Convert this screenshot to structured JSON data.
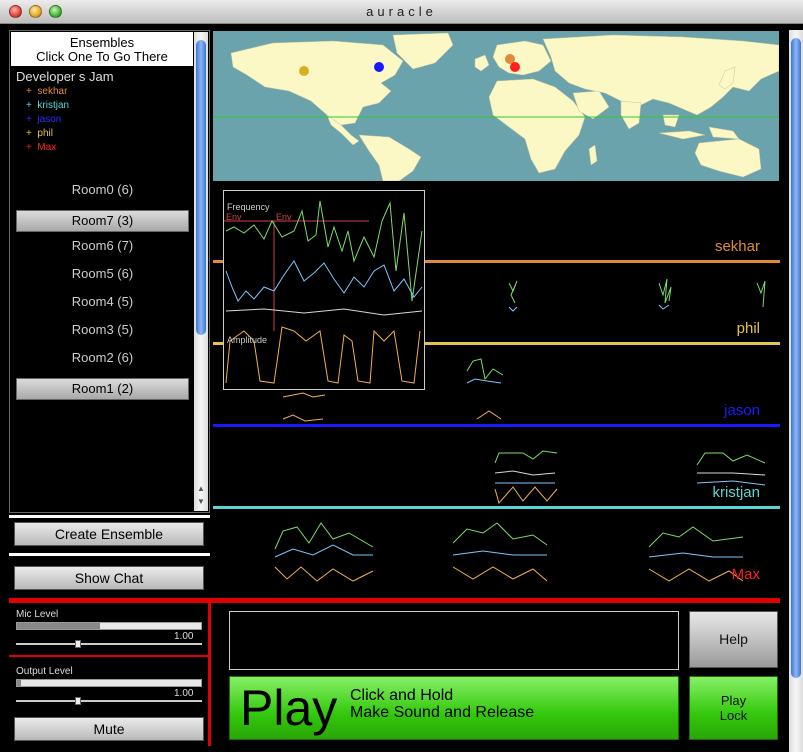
{
  "window": {
    "title": "auracle"
  },
  "ensembles": {
    "header_line1": "Ensembles",
    "header_line2": "Click One To Go There",
    "current": "Developer s Jam",
    "members": [
      {
        "name": "sekhar",
        "color": "#e08a3c"
      },
      {
        "name": "kristjan",
        "color": "#58d6d6"
      },
      {
        "name": "jason",
        "color": "#2a2aff"
      },
      {
        "name": "phil",
        "color": "#e6c34a"
      },
      {
        "name": "Max",
        "color": "#ff2020"
      }
    ],
    "rooms": [
      {
        "label": "Room0 (6)",
        "selected": false
      },
      {
        "label": "Room7 (3)",
        "selected": true
      },
      {
        "label": "Room6 (7)",
        "selected": false
      },
      {
        "label": "Room5 (6)",
        "selected": false
      },
      {
        "label": "Room4 (5)",
        "selected": false
      },
      {
        "label": "Room3 (5)",
        "selected": false
      },
      {
        "label": "Room2 (6)",
        "selected": false
      },
      {
        "label": "Room1 (2)",
        "selected": true
      }
    ]
  },
  "buttons": {
    "create_ensemble": "Create Ensemble",
    "show_chat": "Show Chat",
    "mute": "Mute",
    "help": "Help",
    "play": "Play",
    "play_hint_line1": "Click and Hold",
    "play_hint_line2": "Make Sound and Release",
    "play_lock_line1": "Play",
    "play_lock_line2": "Lock"
  },
  "levels": {
    "mic_label": "Mic Level",
    "mic_value": "1.00",
    "mic_meter": 0.45,
    "output_label": "Output Level",
    "output_value": "1.00",
    "output_meter": 0.02
  },
  "inset": {
    "frequency_label": "Frequency",
    "amplitude_label": "Amplitude",
    "env1": "Env",
    "env2": "Env"
  },
  "lanes": [
    {
      "name": "sekhar",
      "color": "#e08a3c"
    },
    {
      "name": "phil",
      "color": "#e6c34a"
    },
    {
      "name": "jason",
      "color": "#1a1aff"
    },
    {
      "name": "kristjan",
      "color": "#58d6d6"
    },
    {
      "name": "Max",
      "color": "#ff2020"
    }
  ],
  "colors": {
    "map_ocean": "#6ba3ad",
    "map_land": "#fbf8c6",
    "accent_red": "#e00000",
    "play_green": "#33c80c"
  }
}
